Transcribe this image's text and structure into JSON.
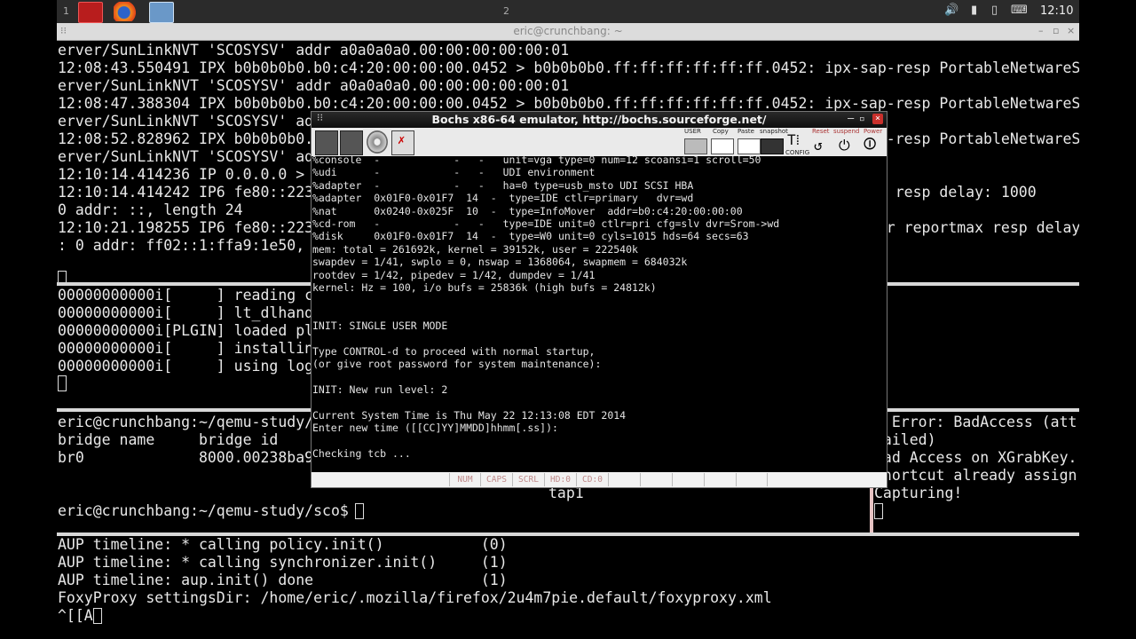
{
  "taskbar": {
    "workspace_1": "1",
    "workspace_2": "2",
    "clock": "12:10"
  },
  "terminal": {
    "title": "eric@crunchbang: ~",
    "pane1": [
      "erver/SunLinkNVT 'SCOSYSV' addr a0a0a0a0.00:00:00:00:00:01",
      "12:08:43.550491 IPX b0b0b0b0.b0:c4:20:00:00:00.0452 > b0b0b0b0.ff:ff:ff:ff:ff:ff.0452: ipx-sap-resp PortableNetwareS",
      "erver/SunLinkNVT 'SCOSYSV' addr a0a0a0a0.00:00:00:00:00:01",
      "12:08:47.388304 IPX b0b0b0b0.b0:c4:20:00:00:00.0452 > b0b0b0b0.ff:ff:ff:ff:ff:ff.0452: ipx-sap-resp PortableNetwareS",
      "erver/SunLinkNVT 'SCOSYSV' addr a0a0a0a0.00:00:00:00:00:01",
      "12:08:52.828962 IPX b0b0b0b0.b0:c4:20:00:00:00.0452 > b0b0b0b0.ff:ff:ff:ff:ff:ff.0452: ipx-sap-resp PortableNetwareS",
      "erver/SunLinkNVT 'SCOSYSV' addr a0a0a0a0.00:00:00:00:00:01",
      "12:10:14.414236 IP 0.0.0.0 > 224.0.0.1: igmp query v2",
      "12:10:14.414242 IP6 fe80::223:8bff:fea9:1e50 > ff02::1: HBH ICMP6, multicast listener querymax resp delay: 1000",
      "0 addr: ::, length 24",
      "12:10:21.198255 IP6 fe80::223:8bff:fea9:1e50 > ff02::1:ffa9:1e50: HBH ICMP6, multicast listener reportmax resp delay",
      ": 0 addr: ff02::1:ffa9:1e50, length 24"
    ],
    "pane2": [
      "00000000000i[     ] reading configuration from .bochsrc",
      "00000000000i[     ] lt_dlhandle is 0x9b6e9c0",
      "00000000000i[PLGIN] loaded plugin libbx_unmapped.so",
      "00000000000i[     ] installing x module as the Bochs GUI",
      "00000000000i[     ] using log file bochsout.txt"
    ],
    "pane3_left": [
      "eric@crunchbang:~/qemu-study/sco$ brctl show",
      "bridge name     bridge id               STP enabled     interfaces",
      "br0             8000.00238ba9ea3c       no              eth0"
    ],
    "pane3_tap": "tap1",
    "pane3_prompt": "eric@crunchbang:~/qemu-study/sco$ ",
    "pane3_right": [
      "X Error: BadAccess (att",
      "failed)",
      "Bad Access on XGrabKey.",
      "shortcut already assign",
      "Capturing!"
    ],
    "pane4": [
      "AUP timeline: * calling policy.init()           (0)",
      "AUP timeline: * calling synchronizer.init()     (1)",
      "AUP timeline: aup.init() done                   (1)",
      "FoxyProxy settingsDir: /home/eric/.mozilla/firefox/2u4m7pie.default/foxyproxy.xml",
      "^[[A"
    ]
  },
  "bochs": {
    "title": "Bochs x86-64 emulator, http://bochs.sourceforge.net/",
    "toolbar": {
      "user": "USER",
      "copy": "Copy",
      "paste": "Paste",
      "snapshot": "snapshot",
      "config": "CONFIG",
      "reset": "Reset",
      "suspend": "suspend",
      "power": "Power"
    },
    "screen": [
      "%console  -            -   -   unit=vga type=0 num=12 scoansi=1 scroll=50",
      "%udi      -            -   -   UDI environment",
      "%adapter  -            -   -   ha=0 type=usb_msto UDI SCSI HBA",
      "%adapter  0x01F0-0x01F7  14  -  type=IDE ctlr=primary   dvr=wd",
      "%nat      0x0240-0x025F  10  -  type=InfoMover  addr=b0:c4:20:00:00:00",
      "%cd-rom   -            -   -   type=IDE unit=0 ctlr=pri cfg=slv dvr=Srom->wd",
      "%disk     0x01F0-0x01F7  14  -  type=W0 unit=0 cyls=1015 hds=64 secs=63",
      "mem: total = 261692k, kernel = 39152k, user = 222540k",
      "swapdev = 1/41, swplo = 0, nswap = 1368064, swapmem = 684032k",
      "rootdev = 1/42, pipedev = 1/42, dumpdev = 1/41",
      "kernel: Hz = 100, i/o bufs = 25836k (high bufs = 24812k)",
      "",
      "",
      "INIT: SINGLE USER MODE",
      "",
      "Type CONTROL-d to proceed with normal startup,",
      "(or give root password for system maintenance):",
      "",
      "INIT: New run level: 2",
      "",
      "Current System Time is Thu May 22 12:13:08 EDT 2014",
      "Enter new time ([[CC]YY]MMDD]hhmm[.ss]):",
      "",
      "Checking tcb ..."
    ],
    "status": {
      "num": "NUM",
      "caps": "CAPS",
      "scrl": "SCRL",
      "hd0": "HD:0",
      "cd0": "CD:0"
    }
  }
}
